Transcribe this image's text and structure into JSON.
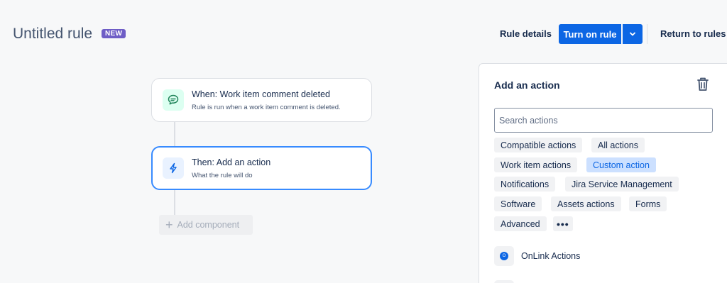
{
  "header": {
    "title": "Untitled rule",
    "badge": "NEW",
    "rule_details": "Rule details",
    "turn_on": "Turn on rule",
    "return": "Return to rules"
  },
  "flow": {
    "trigger": {
      "title": "When: Work item comment deleted",
      "subtitle": "Rule is run when a work item comment is deleted.",
      "icon": "comment-icon"
    },
    "action": {
      "title": "Then: Add an action",
      "subtitle": "What the rule will do",
      "icon": "lightning-icon"
    },
    "add_component": "Add component"
  },
  "panel": {
    "title": "Add an action",
    "search_placeholder": "Search actions",
    "chips": [
      "Compatible actions",
      "All actions",
      "Work item actions",
      "Custom action",
      "Notifications",
      "Jira Service Management",
      "Software",
      "Assets actions",
      "Forms",
      "Advanced"
    ],
    "selected_chip": "Custom action",
    "more": "•••",
    "apps": [
      {
        "label": "OnLink Actions",
        "icon_text": "O"
      }
    ]
  },
  "colors": {
    "primary": "#0c66e4",
    "badge": "#6e5dc6",
    "selected_chip_bg": "#cce0ff",
    "active_border": "#388bff"
  }
}
